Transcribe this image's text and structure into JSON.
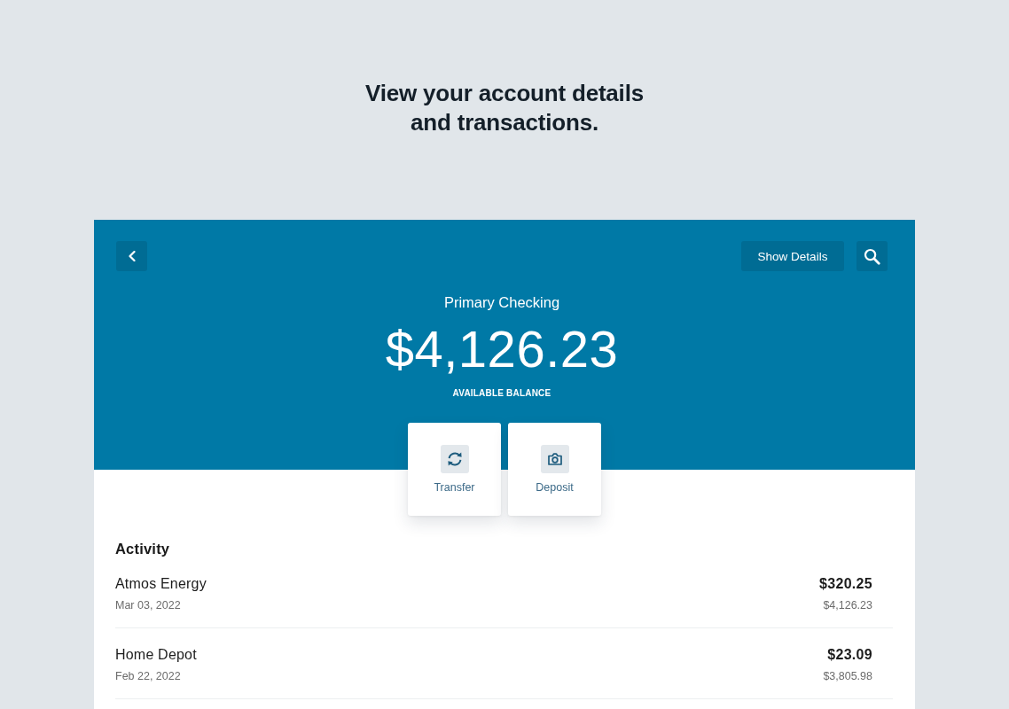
{
  "headline": "View your account details and transactions.",
  "toolbar": {
    "show_details": "Show Details"
  },
  "account": {
    "name": "Primary Checking",
    "balance": "$4,126.23",
    "balance_label": "AVAILABLE BALANCE"
  },
  "actions": [
    {
      "kind": "transfer",
      "label": "Transfer"
    },
    {
      "kind": "deposit",
      "label": "Deposit"
    }
  ],
  "activity": {
    "title": "Activity",
    "transactions": [
      {
        "payee": "Atmos Energy",
        "date": "Mar 03, 2022",
        "amount": "$320.25",
        "balance": "$4,126.23"
      },
      {
        "payee": "Home Depot",
        "date": "Feb 22, 2022",
        "amount": "$23.09",
        "balance": "$3,805.98"
      }
    ]
  }
}
